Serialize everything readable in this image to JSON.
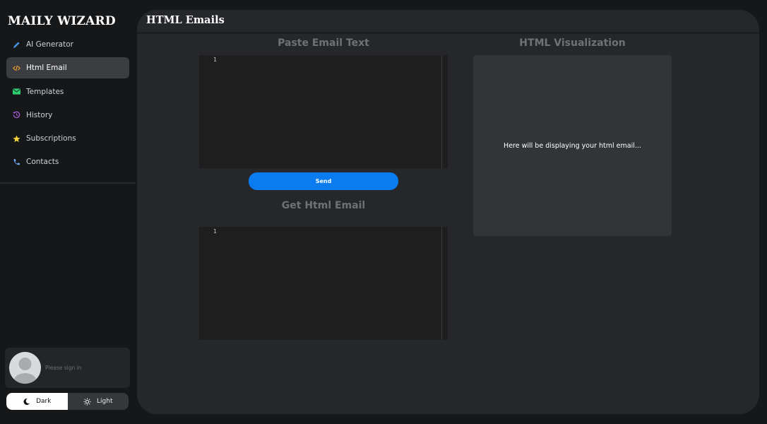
{
  "sidebar": {
    "brand": "MAILY WIZARD",
    "items": [
      {
        "label": "AI Generator",
        "icon": "pencil-icon",
        "active": false
      },
      {
        "label": "Html Email",
        "icon": "code-icon",
        "active": true
      },
      {
        "label": "Templates",
        "icon": "envelope-icon",
        "active": false
      },
      {
        "label": "History",
        "icon": "history-icon",
        "active": false
      },
      {
        "label": "Subscriptions",
        "icon": "star-icon",
        "active": false
      },
      {
        "label": "Contacts",
        "icon": "phone-icon",
        "active": false
      }
    ],
    "user": {
      "status": "Please sign in"
    },
    "theme": {
      "dark_label": "Dark",
      "light_label": "Light",
      "selected": "Dark"
    }
  },
  "main": {
    "title": "HTML Emails",
    "paste_title": "Paste Email Text",
    "paste_editor": {
      "line": "1"
    },
    "send_label": "Send",
    "get_title": "Get Html Email",
    "get_editor": {
      "line": "1"
    },
    "preview_title": "HTML Visualization",
    "preview_placeholder": "Here will be displaying your html email..."
  },
  "colors": {
    "accent": "#0a7cf0",
    "background": "#161719",
    "panel": "#25272a",
    "editor": "#1e1e1e",
    "preview": "#323538",
    "icon_pencil": "#4a90e2",
    "icon_code": "#f0a030",
    "icon_envelope": "#2ecc71",
    "icon_history": "#a65fd6",
    "icon_star": "#f4d03f",
    "icon_phone": "#6fa8f0"
  }
}
